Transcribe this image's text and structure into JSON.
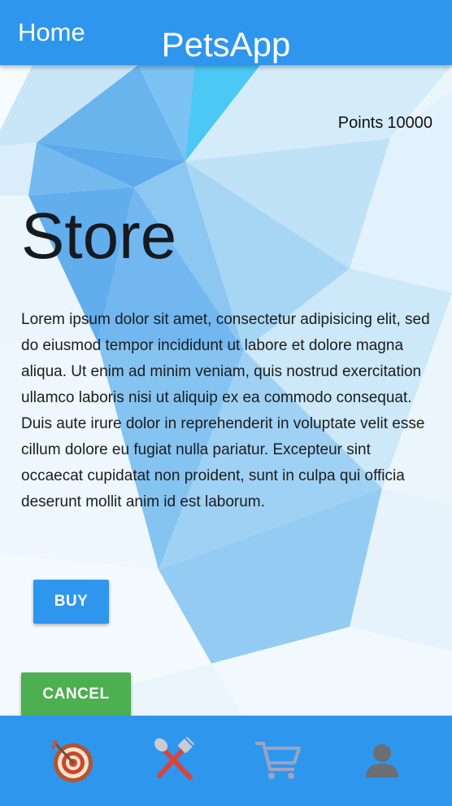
{
  "header": {
    "home_label": "Home",
    "app_title": "PetsApp"
  },
  "points": {
    "label": "Points",
    "value": "10000"
  },
  "page": {
    "title": "Store",
    "description": "Lorem ipsum dolor sit amet, consectetur adipisicing elit, sed do eiusmod tempor incididunt ut labore et dolore magna aliqua. Ut enim ad minim veniam, quis nostrud exercitation ullamco laboris nisi ut aliquip ex ea commodo consequat. Duis aute irure dolor in reprehenderit in voluptate velit esse cillum dolore eu fugiat nulla pariatur. Excepteur sint occaecat cupidatat non proident, sunt in culpa qui officia deserunt mollit anim id est laborum."
  },
  "buttons": {
    "buy_label": "BUY",
    "cancel_label": "CANCEL"
  },
  "bottom_nav": {
    "items": [
      {
        "icon": "target-icon"
      },
      {
        "icon": "fork-spoon-icon"
      },
      {
        "icon": "shopping-cart-icon"
      },
      {
        "icon": "user-icon"
      }
    ]
  },
  "colors": {
    "primary": "#2f96ee",
    "cancel": "#4caf50",
    "background": "#e8f4fc"
  }
}
